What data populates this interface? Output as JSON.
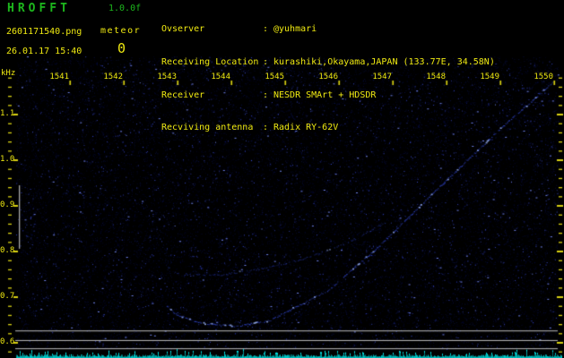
{
  "header": {
    "title": "HROFFT",
    "version": "1.0.0f",
    "filename": "2601171540.png",
    "datetime": "26.01.17 15:40",
    "meteor_label": "meteor",
    "meteor_count": "0",
    "info": {
      "colon": ":",
      "rows": [
        {
          "label": "Ovserver",
          "value": "@yuhmari"
        },
        {
          "label": "Receiving Location",
          "value": "kurashiki,Okayama,JAPAN (133.77E, 34.58N)"
        },
        {
          "label": "Receiver",
          "value": "NESDR SMArt + HDSDR"
        },
        {
          "label": "Recviving antenna",
          "value": "Radix RY-62V"
        }
      ]
    }
  },
  "axes": {
    "y_unit": "kHz",
    "time_labels": [
      "1541",
      "1542",
      "1543",
      "1544",
      "1545",
      "1546",
      "1547",
      "1548",
      "1549",
      "1550"
    ],
    "freq_labels": [
      "1.1",
      "1.0",
      "0.9",
      "0.8",
      "0.7",
      "0.6"
    ]
  },
  "colors": {
    "text_yellow": "#efe911",
    "text_green": "#1db71d",
    "tick_yellow": "#d8d012",
    "noise_blue": "#2233cc",
    "trace_blue": "#3c55f5",
    "trace_bright": "#96afff",
    "signal_cyan": "#00d9d9",
    "grid_gray": "#bcbcbc",
    "background": "#000000"
  },
  "chart_data": {
    "type": "heatmap",
    "description": "HROFFT 10-minute radio meteor observation spectrogram: blue noise background, a curved Doppler echo trace, horizontal reference lines near 0.6 kHz, and a cyan signal-level strip along the bottom edge. Meteor count shown: 0.",
    "x_axis": {
      "unit": "hhmm",
      "start": "15:40",
      "end": "15:50",
      "ticks": [
        "1541",
        "1542",
        "1543",
        "1544",
        "1545",
        "1546",
        "1547",
        "1548",
        "1549",
        "1550"
      ]
    },
    "y_axis": {
      "unit": "kHz",
      "ticks": [
        1.1,
        1.0,
        0.9,
        0.8,
        0.7,
        0.6
      ],
      "min": 0.575,
      "max": 1.175
    },
    "gridlines_khz": [
      0.627,
      0.606,
      0.588
    ],
    "left_band_marker_khz": [
      0.806,
      0.945
    ],
    "meteor_count": 0,
    "traces": [
      {
        "name": "faint-upper-echo",
        "points": [
          [
            2.78,
            0.769
          ],
          [
            3.03,
            0.751
          ],
          [
            3.78,
            0.749
          ],
          [
            4.53,
            0.763
          ],
          [
            5.28,
            0.782
          ],
          [
            6.12,
            0.818
          ],
          [
            6.87,
            0.865
          ]
        ]
      },
      {
        "name": "main-doppler-echo",
        "points": [
          [
            2.78,
            0.684
          ],
          [
            2.98,
            0.661
          ],
          [
            3.45,
            0.643
          ],
          [
            4.07,
            0.637
          ],
          [
            4.7,
            0.649
          ],
          [
            5.2,
            0.68
          ],
          [
            5.78,
            0.714
          ],
          [
            6.7,
            0.808
          ],
          [
            7.87,
            0.943
          ],
          [
            9.03,
            1.074
          ],
          [
            9.98,
            1.172
          ]
        ]
      }
    ],
    "signal_strip": {
      "description": "cyan signal-level graph at bottom, 15:40-15:50",
      "color": "#00d9d9"
    }
  }
}
